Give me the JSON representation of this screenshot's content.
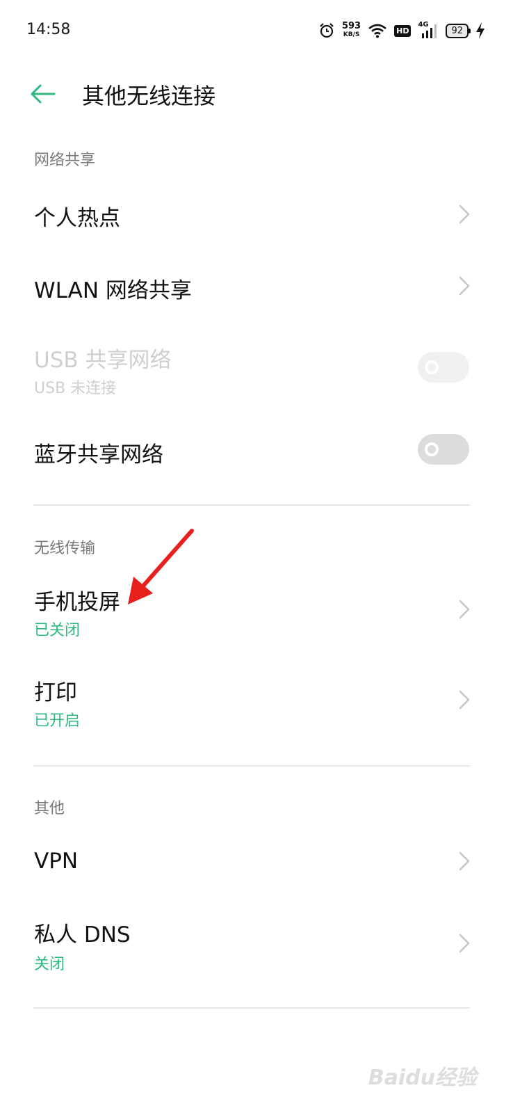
{
  "status_bar": {
    "time": "14:58",
    "net_speed": "593",
    "net_unit": "KB/S",
    "hd_label": "HD",
    "signal_label": "4G",
    "battery": "92"
  },
  "header": {
    "title": "其他无线连接"
  },
  "sections": {
    "sharing": {
      "title": "网络共享",
      "hotspot": "个人热点",
      "wlan_share": "WLAN 网络共享",
      "usb_share": "USB 共享网络",
      "usb_share_sub": "USB 未连接",
      "bt_share": "蓝牙共享网络"
    },
    "wireless": {
      "title": "无线传输",
      "screencast": "手机投屏",
      "screencast_sub": "已关闭",
      "print": "打印",
      "print_sub": "已开启"
    },
    "other": {
      "title": "其他",
      "vpn": "VPN",
      "dns": "私人 DNS",
      "dns_sub": "关闭"
    }
  },
  "watermark": "Baidu经验",
  "colors": {
    "accent": "#2fb87f",
    "annotation_arrow": "#e8201d"
  }
}
